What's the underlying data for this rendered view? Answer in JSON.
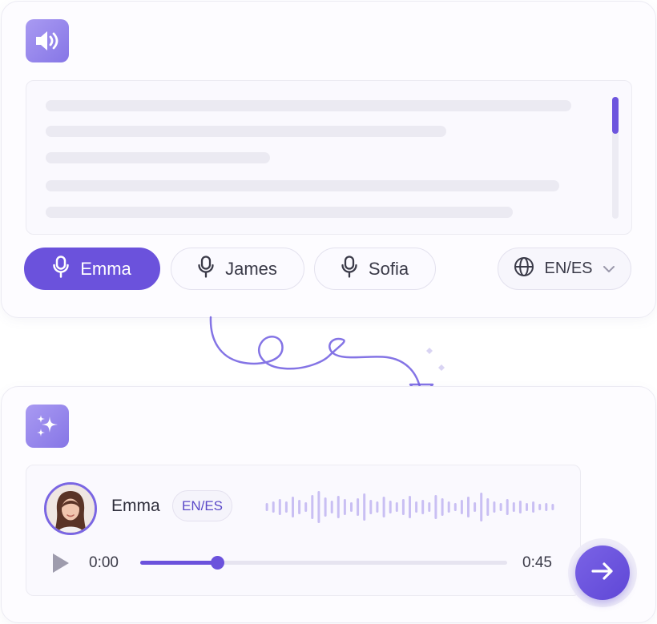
{
  "input_card": {
    "icon": "speaker-icon",
    "voices": [
      {
        "label": "Emma",
        "icon": "microphone-icon",
        "selected": true
      },
      {
        "label": "James",
        "icon": "microphone-icon",
        "selected": false
      },
      {
        "label": "Sofia",
        "icon": "microphone-icon",
        "selected": false
      }
    ],
    "language": {
      "label": "EN/ES",
      "icon": "globe-icon",
      "chevron": "chevron-down-icon"
    }
  },
  "output_card": {
    "icon": "sparkles-icon",
    "player": {
      "speaker": "Emma",
      "language": "EN/ES",
      "current_time": "0:00",
      "total_time": "0:45",
      "progress": 0.21
    },
    "next_icon": "arrow-right-icon"
  },
  "colors": {
    "accent": "#6b52dc",
    "tile_gradient_start": "#a99af2",
    "tile_gradient_end": "#8676e6",
    "placeholder_line": "#ebeaf2",
    "waveform": "#c9bff3"
  }
}
